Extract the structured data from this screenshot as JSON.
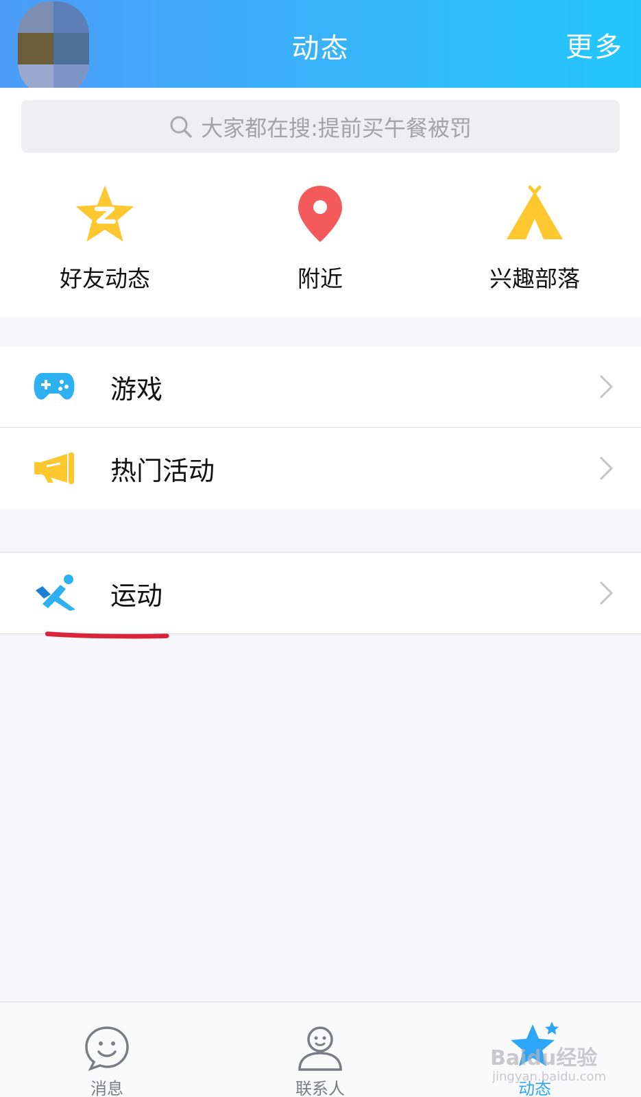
{
  "header": {
    "title": "动态",
    "more_label": "更多"
  },
  "search": {
    "placeholder": "大家都在搜:提前买午餐被罚"
  },
  "shortcuts": [
    {
      "label": "好友动态",
      "icon": "qzone-star-icon",
      "color": "#fcc72f"
    },
    {
      "label": "附近",
      "icon": "location-pin-icon",
      "color": "#f55a5a"
    },
    {
      "label": "兴趣部落",
      "icon": "tent-icon",
      "color": "#fcc72f"
    }
  ],
  "list": [
    {
      "label": "游戏",
      "icon": "gamepad-icon",
      "color": "#2eb1f0"
    },
    {
      "label": "热门活动",
      "icon": "megaphone-icon",
      "color": "#fcc72f"
    },
    {
      "label": "运动",
      "icon": "running-icon",
      "color": "#2eb1f0"
    }
  ],
  "tabbar": {
    "tabs": [
      {
        "label": "消息",
        "icon": "chat-smile-icon",
        "active": false
      },
      {
        "label": "联系人",
        "icon": "contact-person-icon",
        "active": false
      },
      {
        "label": "动态",
        "icon": "star-icon",
        "active": true
      }
    ]
  },
  "watermark": {
    "text": "Baidu经验",
    "sub": "jingyan.baidu.com"
  },
  "colors": {
    "header_gradient_start": "#4d9cf6",
    "header_gradient_end": "#22c6fd",
    "active_tab": "#2ea6f7",
    "annotation_underline": "#d9243a"
  }
}
